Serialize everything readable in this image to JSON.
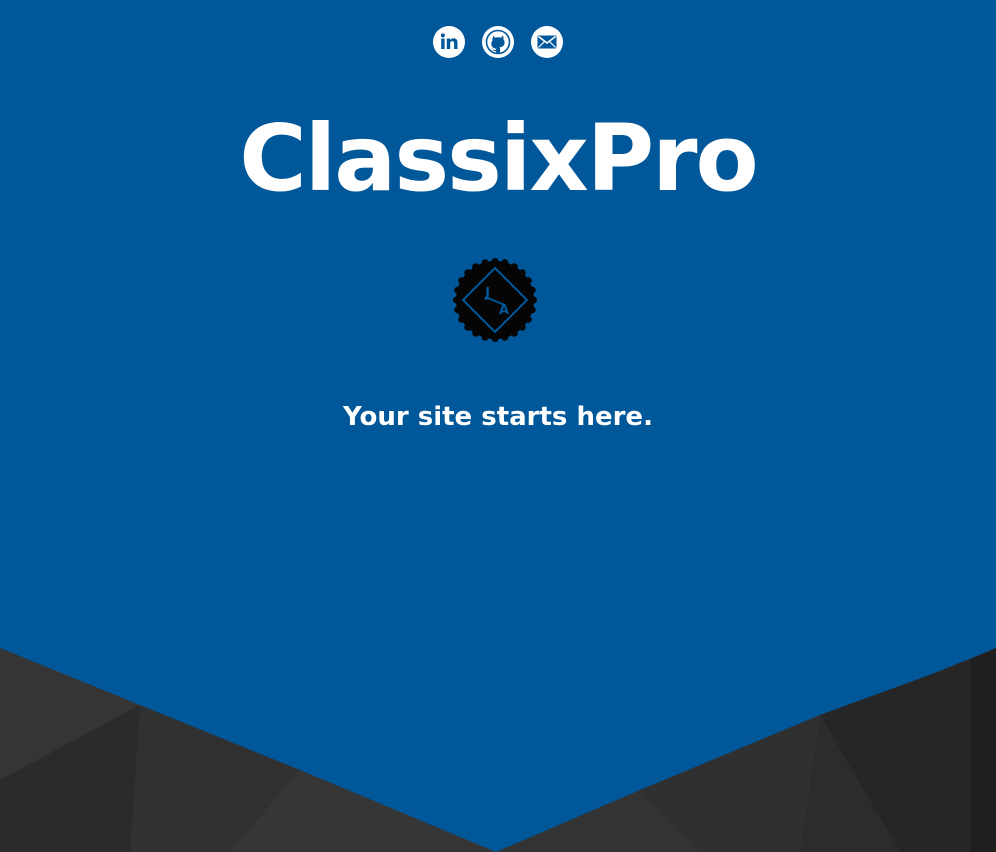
{
  "site": {
    "title": "ClassixPro",
    "tagline": "Your site starts here."
  },
  "social_links": [
    {
      "name": "linkedin",
      "icon": "linkedin-icon"
    },
    {
      "name": "github",
      "icon": "github-icon"
    },
    {
      "name": "email",
      "icon": "email-icon"
    }
  ],
  "badge": {
    "monogram_top": "J",
    "monogram_bottom": "A"
  },
  "colors": {
    "background": "#005799",
    "text": "#ffffff",
    "dark_band": "#2b2b2b"
  }
}
